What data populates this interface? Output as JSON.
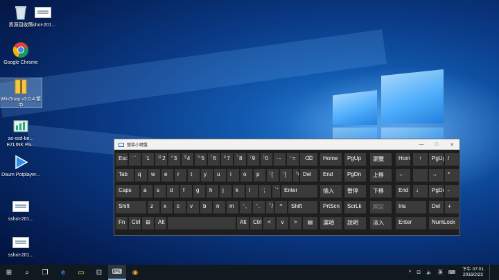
{
  "desktop_icons": [
    {
      "label": "資源回收筒"
    },
    {
      "label": "sshot-201..."
    },
    {
      "label": "Google Chrome"
    },
    {
      "label": "WinSnap v3.0.4 繁中"
    },
    {
      "label": "as-ssd-be... EZLINK Pa..."
    },
    {
      "label": "Daum Potplayer..."
    },
    {
      "label": "sshot-201..."
    },
    {
      "label": "sshot-201..."
    }
  ],
  "osk": {
    "title": "螢幕小鍵盤",
    "keys": {
      "esc": "Esc",
      "tilde_sub": "~",
      "tilde": "`",
      "d1s": "!",
      "d1": "1",
      "d2s": "@",
      "d2": "2",
      "d3s": "#",
      "d3": "3",
      "d4s": "$",
      "d4": "4",
      "d5s": "%",
      "d5": "5",
      "d6s": "^",
      "d6": "6",
      "d7s": "&",
      "d7": "7",
      "d8s": "*",
      "d8": "8",
      "d9s": "(",
      "d9": "9",
      "d0s": ")",
      "d0": "0",
      "minus_s": "_",
      "minus": "-",
      "eq_s": "+",
      "eq": "=",
      "backspace": "⌫",
      "home": "Home",
      "pgup": "PgUp",
      "browse": "瀏覽",
      "tab": "Tab",
      "q": "q",
      "w": "w",
      "e": "e",
      "r": "r",
      "t": "t",
      "y": "y",
      "u": "u",
      "i": "i",
      "o": "o",
      "p": "p",
      "lbr_s": "{",
      "lbr": "[",
      "rbr_s": "}",
      "rbr": "]",
      "bsl_s": "|",
      "bsl": "\\",
      "del": "Del",
      "end": "End",
      "pgdn": "PgDn",
      "move_down": "上移",
      "caps": "Caps",
      "a": "a",
      "s": "s",
      "d": "d",
      "f": "f",
      "g": "g",
      "h": "h",
      "j": "j",
      "k": "k",
      "l": "l",
      "semi_s": ":",
      "semi": ";",
      "quote_s": "\"",
      "quote": "'",
      "enter": "Enter",
      "insert": "插入",
      "pause": "暫停",
      "move_up": "下移",
      "shift": "Shift",
      "z": "z",
      "x": "x",
      "c": "c",
      "v": "v",
      "b": "b",
      "n": "n",
      "m": "m",
      "comma_s": "<",
      "comma": ",",
      "period_s": ">",
      "period": ".",
      "slash_s": "?",
      "slash": "/",
      "up_arrow": "^",
      "shift_r": "Shift",
      "prtscn": "PrtScn",
      "scrlk": "ScrLk",
      "dock": "固定",
      "fn": "Fn",
      "ctrl": "Ctrl",
      "win": "⊞",
      "alt": "Alt",
      "alt_r": "Alt",
      "ctrl_r": "Ctrl",
      "left": "<",
      "down": "v",
      "right": ">",
      "menu": "▤",
      "options": "選項",
      "help": "說明",
      "fade": "淡入"
    },
    "numpad": {
      "home": "Home",
      "up": "↑",
      "pgup": "PgUp",
      "div": "/",
      "left": "←",
      "right": "→",
      "mul": "*",
      "end": "End",
      "down": "↓",
      "pgdn": "PgDn",
      "minus": "-",
      "ins": "Ins",
      "del": "Del",
      "plus": "+",
      "enter": "Enter",
      "numlock": "NumLock"
    }
  },
  "taskbar": {
    "start": "⊞",
    "search": "⌕",
    "taskview": "❐",
    "edge": "e",
    "explorer": "▭",
    "store": "⊡",
    "osk_app": "⌨",
    "chrome": "◉",
    "tray": {
      "chevron": "^",
      "network": "⊡",
      "volume": "🔈",
      "ime": "英",
      "keyboard": "⌨"
    },
    "time": "下午 07:01",
    "date": "2016/2/23"
  }
}
